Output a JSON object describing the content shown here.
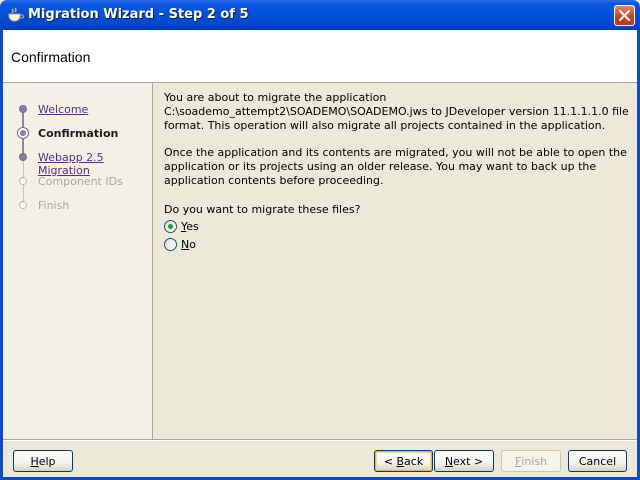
{
  "window": {
    "title": "Migration Wizard - Step 2 of 5"
  },
  "header": {
    "title": "Confirmation"
  },
  "steps": [
    {
      "label": "Welcome",
      "state": "done"
    },
    {
      "label": "Confirmation",
      "state": "current"
    },
    {
      "label": "Webapp 2.5 Migration",
      "state": "done"
    },
    {
      "label": "Component IDs",
      "state": "future"
    },
    {
      "label": "Finish",
      "state": "future"
    }
  ],
  "content": {
    "para1": "You are about to migrate the application C:\\soademo_attempt2\\SOADEMO\\SOADEMO.jws to JDeveloper version 11.1.1.1.0 file format. This operation will also migrate all projects contained in the application.",
    "para2": "Once the application and its contents are migrated, you will not be able to open the application or its projects using an older release. You may want to back up the application contents before proceeding.",
    "question": "Do you want to migrate these files?",
    "options": [
      {
        "mnemonic": "Y",
        "rest": "es",
        "checked": true
      },
      {
        "mnemonic": "N",
        "rest": "o",
        "checked": false
      }
    ]
  },
  "buttons": {
    "help": {
      "mnemonic": "H",
      "rest": "elp"
    },
    "back": {
      "prefix": "< ",
      "mnemonic": "B",
      "rest": "ack"
    },
    "next": {
      "mnemonic": "N",
      "rest": "ext >"
    },
    "finish": {
      "mnemonic": "F",
      "rest": "inish"
    },
    "cancel": {
      "label": "Cancel"
    }
  },
  "colors": {
    "titlebar": "#0350d6",
    "step_link": "#5a2f86",
    "step_marker": "#8e7ca6",
    "radio_dot": "#21a121"
  },
  "icons": {
    "title": "jdeveloper-cup-icon",
    "close": "close-x-icon"
  }
}
